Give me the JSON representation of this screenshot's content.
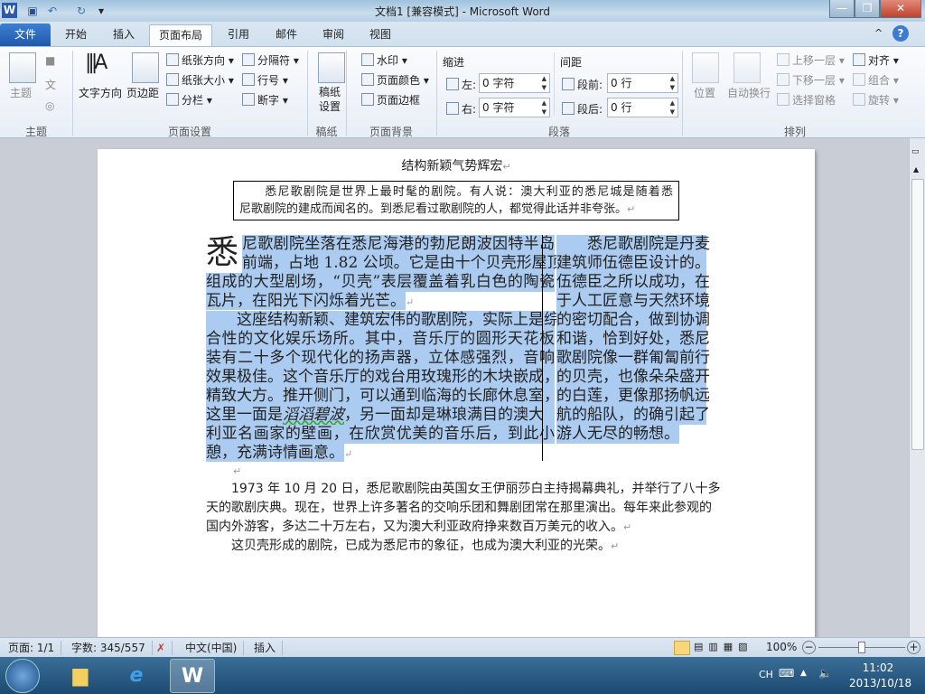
{
  "window": {
    "title": "文档1 [兼容模式] - Microsoft Word",
    "app_icon": "W",
    "minimize": "—",
    "restore": "❐",
    "close": "✕",
    "help": "?",
    "collapse": "^"
  },
  "quick_access": {
    "save_icon": "save-icon",
    "undo": "↶",
    "redo": "↻",
    "customize": "▾"
  },
  "tabs": {
    "file": "文件",
    "items": [
      "开始",
      "插入",
      "页面布局",
      "引用",
      "邮件",
      "审阅",
      "视图"
    ],
    "active": "页面布局"
  },
  "ribbon": {
    "theme": {
      "themes": "主题",
      "colors": "■",
      "fonts": "文",
      "effects": "◎",
      "group": "主题"
    },
    "page_setup": {
      "text_direction": "文字方向",
      "margins": "页边距",
      "orientation": "纸张方向",
      "size": "纸张大小",
      "columns": "分栏",
      "breaks": "分隔符",
      "line_numbers": "行号",
      "hyphenation": "断字",
      "group": "页面设置"
    },
    "manuscript": {
      "setup_l1": "稿纸",
      "setup_l2": "设置",
      "group": "稿纸"
    },
    "background": {
      "watermark": "水印",
      "page_color": "页面颜色",
      "page_borders": "页面边框",
      "group": "页面背景"
    },
    "paragraph": {
      "indent": "缩进",
      "left_label": "左:",
      "left_value": "0 字符",
      "right_label": "右:",
      "right_value": "0 字符",
      "spacing": "间距",
      "before_label": "段前:",
      "before_value": "0 行",
      "after_label": "段后:",
      "after_value": "0 行",
      "group": "段落"
    },
    "arrange": {
      "position": "位置",
      "wrap": "自动换行",
      "bring_forward": "上移一层",
      "send_backward": "下移一层",
      "selection_pane": "选择窗格",
      "align": "对齐",
      "group_obj": "组合",
      "rotate": "旋转",
      "group": "排列"
    }
  },
  "document": {
    "title": "结构新颖气势辉宏",
    "box_lines": [
      "　　悉尼歌剧院是世界上最时髦的剧院。有人说：澳大利亚的悉尼城是随着悉",
      "尼歌剧院的建成而闻名的。到悉尼看过歌剧院的人，都觉得此话并非夸张。"
    ],
    "drop_cap": "悉",
    "left_lines": [
      "尼歌剧院坐落在悉尼海港的勃尼朗波因特半岛",
      "前端，占地 1.82 公顷。它是由十个贝壳形屋顶",
      "组成的大型剧场，“贝壳”表层覆盖着乳白色的陶瓷",
      "瓦片，在阳光下闪烁着光芒。",
      "　　这座结构新颖、建筑宏伟的歌剧院，实际上是综",
      "合性的文化娱乐场所。其中，音乐厅的圆形天花板",
      "装有二十多个现代化的扬声器，立体感强烈，音响",
      "效果极佳。这个音乐厅的戏台用玫瑰形的木块嵌成，",
      "精致大方。推开侧门，可以通到临海的长廊休息室，",
      "这里一面是",
      "滔滔碧波",
      "，另一面却是琳琅满目的澳大",
      "利亚名画家的壁画，在欣赏优美的音乐后，到此小",
      "憩，充满诗情画意。"
    ],
    "right_lines": [
      "　　悉尼歌剧院是丹麦",
      "建筑师伍德臣设计的。",
      "伍德臣之所以成功，在",
      "于人工匠意与天然环境",
      "的密切配合，做到协调",
      "和谐，恰到好处，悉尼",
      "歌剧院像一群匍匐前行",
      "的贝壳，也像朵朵盛开",
      "的白莲，更像那扬帆远",
      "航的船队，的确引起了",
      "游人无尽的畅想。"
    ],
    "bottom_lines": [
      "　　1973 年 10 月 20 日，悉尼歌剧院由英国女王伊丽莎白主持揭幕典礼，并举行了八十多",
      "天的歌剧庆典。现在，世界上许多著名的交响乐团和舞剧团常在那里演出。每年来此参观的",
      "国内外游客，多达二十万左右，又为澳大利亚政府挣来数百万美元的收入。",
      "　　这贝壳形成的剧院，已成为悉尼市的象征，也成为澳大利亚的光荣。"
    ],
    "para_mark": "↵"
  },
  "status": {
    "page": "页面: 1/1",
    "words": "字数: 345/557",
    "language": "中文(中国)",
    "mode": "插入",
    "zoom": "100%",
    "zoom_level": 100
  },
  "taskbar": {
    "ime": "CH",
    "time": "11:02",
    "date": "2013/10/18"
  },
  "colors": {
    "selection": "#abcbf0",
    "file_tab": "#2b6cc0"
  }
}
